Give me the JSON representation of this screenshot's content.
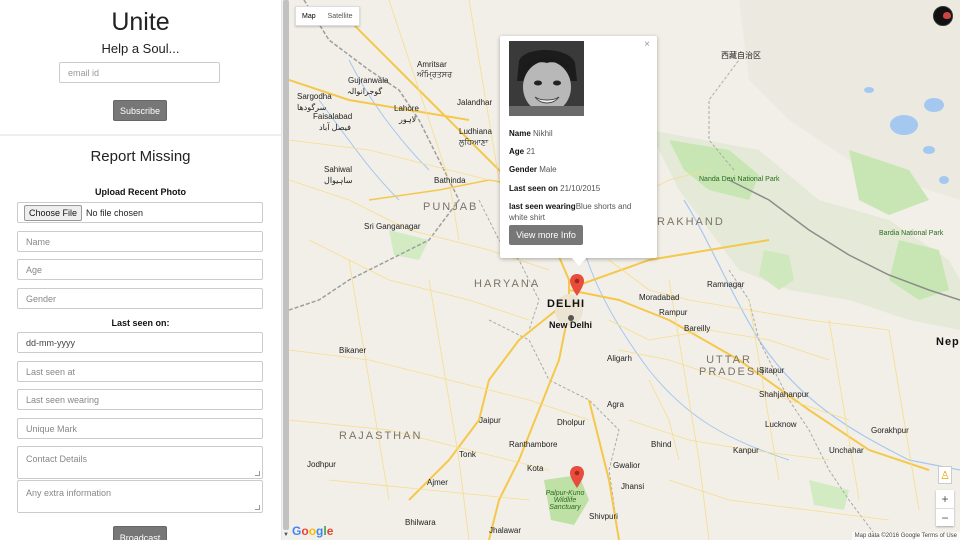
{
  "sidebar": {
    "title": "Unite",
    "tagline": "Help a Soul...",
    "email_placeholder": "email id",
    "subscribe_label": "Subscribe",
    "report_title": "Report Missing",
    "upload_label": "Upload Recent Photo",
    "file_button": "Choose File",
    "file_status": "No file chosen",
    "name_placeholder": "Name",
    "age_placeholder": "Age",
    "gender_placeholder": "Gender",
    "last_seen_on_label": "Last seen on:",
    "date_value": "dd-mm-yyyy",
    "last_seen_at_placeholder": "Last seen at",
    "last_seen_wearing_placeholder": "Last seen wearing",
    "unique_mark_placeholder": "Unique Mark",
    "contact_placeholder": "Contact Details",
    "extra_placeholder": "Any extra information",
    "broadcast_label": "Broadcast"
  },
  "map": {
    "type_map": "Map",
    "type_satellite": "Satellite",
    "zoom_in": "+",
    "zoom_out": "−",
    "google_logo": "Google",
    "attribution": "Map data ©2016 Google   Terms of Use",
    "labels": {
      "gujranwala": "Gujranwala",
      "gujranwala_ur": "گوجرانوالہ",
      "sargodha": "Sargodha",
      "sargodha_ur": "سرگودھا",
      "lahore": "Lahore",
      "lahore_ur": "لاہور",
      "faisalabad": "Faisalabad",
      "faisalabad_ur": "فیصل آباد",
      "sahiwal": "Sahiwal",
      "sahiwal_ur": "ساہیوال",
      "amritsar": "Amritsar",
      "amritsar_hi": "ਅੰਮ੍ਰਿਤਸਰ",
      "jalandhar": "Jalandhar",
      "ludhiana": "Ludhiana",
      "ludhiana_hi": "ਲੁਧਿਆਣਾ",
      "punjab": "PUNJAB",
      "bathinda": "Bathinda",
      "ganganagar": "Sri Ganganagar",
      "haryana": "HARYANA",
      "delhi": "DELHI",
      "new_delhi": "New Delhi",
      "uttarakhand": "RAKHAND",
      "tibet": "西藏自治区",
      "nanda_devi": "Nanda Devi National Park",
      "ramnagar": "Ramnagar",
      "moradabad": "Moradabad",
      "rampur": "Rampur",
      "bareilly": "Bareilly",
      "kathmandu_area": "Nep",
      "bardia": "Bardia National Park",
      "bikaner": "Bikaner",
      "aligarh": "Aligarh",
      "uttar_pradesh": "UTTAR PRADESH",
      "agra": "Agra",
      "jaipur": "Jaipur",
      "rajasthan": "RAJASTHAN",
      "lucknow": "Lucknow",
      "kanpur": "Kanpur",
      "bhind": "Bhind",
      "gwalior": "Gwalior",
      "jhansi": "Jhansi",
      "ajmer": "Ajmer",
      "jodhpur": "Jodhpur",
      "kota": "Kota",
      "bhilwara": "Bhilwara",
      "jhalawar": "Jhalawar",
      "kuno": "Palpur-Kuno Wildlife Sanctuary",
      "unchahar": "Unchahar",
      "sitapur": "Sitapur",
      "shahjahanpur": "Shahjahanpur",
      "gorakhpur": "Gorakhpur",
      "dholpur": "Dholpur",
      "tonk": "Tonk",
      "shivpuri": "Shivpuri",
      "ranthambore": "Ranthambore"
    }
  },
  "info": {
    "name_label": "Name",
    "name_value": "Nikhil",
    "age_label": "Age",
    "age_value": "21",
    "gender_label": "Gender",
    "gender_value": "Male",
    "seen_label": "Last seen on",
    "seen_value": "21/10/2015",
    "wearing_label": "last seen wearing",
    "wearing_value": "Blue shorts and white shirt",
    "more_button": "View more Info",
    "close": "×"
  },
  "colors": {
    "button": "#777777",
    "marker": "#e74c3c",
    "park": "#c8e6b4"
  }
}
